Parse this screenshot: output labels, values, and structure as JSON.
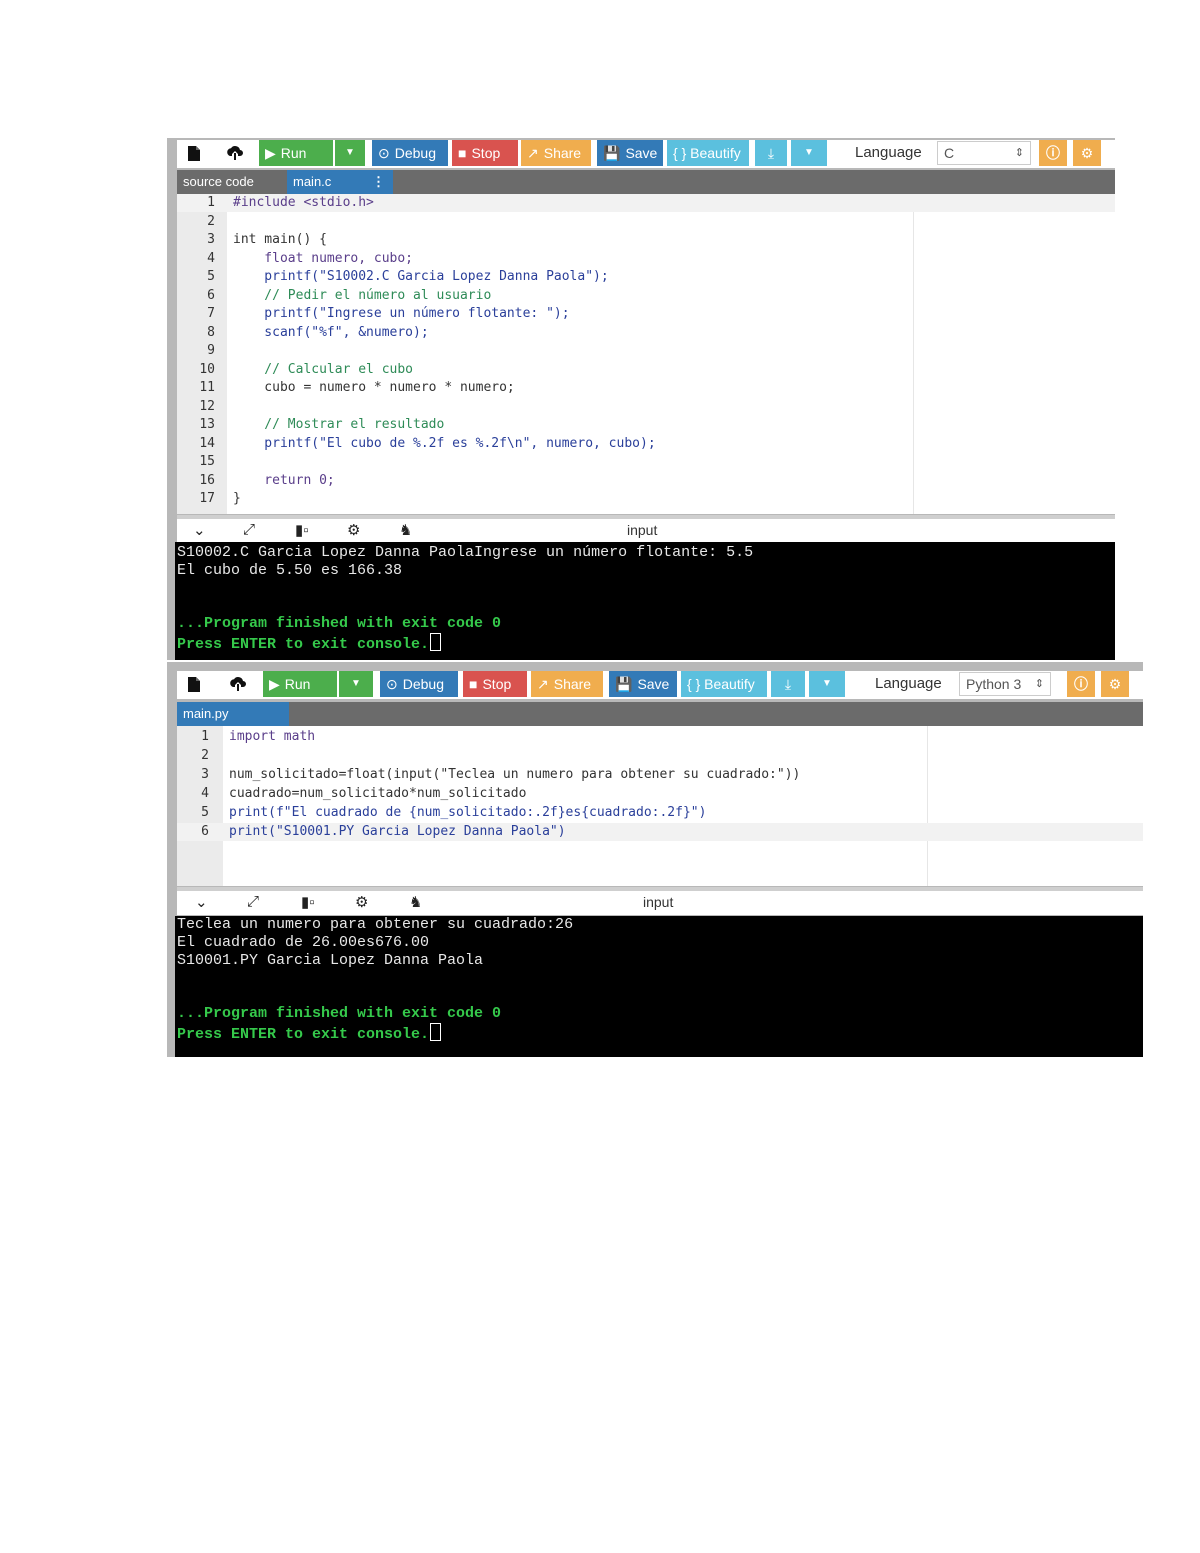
{
  "toolbar": {
    "run_label": "Run",
    "debug_label": "Debug",
    "stop_label": "Stop",
    "share_label": "Share",
    "save_label": "Save",
    "beautify_label": "{ } Beautify",
    "language_label": "Language",
    "icons": [
      "new-file-icon",
      "upload-icon",
      "run-icon",
      "dropdown-icon",
      "debug-icon",
      "stop-icon",
      "share-icon",
      "save-icon",
      "download-icon",
      "info-icon",
      "settings-icon"
    ]
  },
  "colors": {
    "run": "#4cae4c",
    "debug": "#337ab7",
    "stop": "#d9534f",
    "share": "#f0ad4e",
    "save": "#337ab7",
    "beautify": "#5bc0de",
    "download": "#5bc0de",
    "console_bg": "#000000",
    "console_status": "#35c94b"
  },
  "panel1": {
    "language_value": "C",
    "tabs": [
      "source code",
      "main.c"
    ],
    "tab_menu_icon": "⋮",
    "code": [
      "#include <stdio.h>",
      "",
      "int main() {",
      "    float numero, cubo;",
      "    printf(\"S10002.C Garcia Lopez Danna Paola\");",
      "    // Pedir el número al usuario",
      "    printf(\"Ingrese un número flotante: \");",
      "    scanf(\"%f\", &numero);",
      "",
      "    // Calcular el cubo",
      "    cubo = numero * numero * numero;",
      "",
      "    // Mostrar el resultado",
      "    printf(\"El cubo de %.2f es %.2f\\n\", numero, cubo);",
      "",
      "    return 0;",
      "}"
    ],
    "line_numbers": [
      "1",
      "2",
      "3",
      "4",
      "5",
      "6",
      "7",
      "8",
      "9",
      "10",
      "11",
      "12",
      "13",
      "14",
      "15",
      "16",
      "17"
    ],
    "io_title": "input",
    "console": [
      "S10002.C Garcia Lopez Danna PaolaIngrese un número flotante: 5.5",
      "El cubo de 5.50 es 166.38",
      "",
      "",
      "...Program finished with exit code 0",
      "Press ENTER to exit console."
    ]
  },
  "panel2": {
    "language_value": "Python 3",
    "tabs": [
      "main.py"
    ],
    "code": [
      "import math",
      "",
      "num_solicitado=float(input(\"Teclea un numero para obtener su cuadrado:\"))",
      "cuadrado=num_solicitado*num_solicitado",
      "print(f\"El cuadrado de {num_solicitado:.2f}es{cuadrado:.2f}\")",
      "print(\"S10001.PY Garcia Lopez Danna Paola\")"
    ],
    "line_numbers": [
      "1",
      "2",
      "3",
      "4",
      "5",
      "6"
    ],
    "io_title": "input",
    "console": [
      "Teclea un numero para obtener su cuadrado:26",
      "El cuadrado de 26.00es676.00",
      "S10001.PY Garcia Lopez Danna Paola",
      "",
      "",
      "...Program finished with exit code 0",
      "Press ENTER to exit console."
    ]
  }
}
